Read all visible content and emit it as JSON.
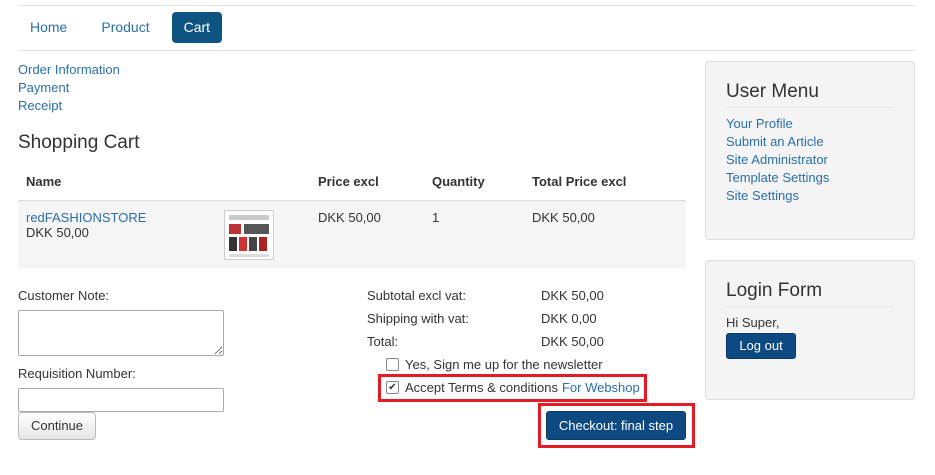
{
  "nav": {
    "items": [
      {
        "label": "Home",
        "active": false
      },
      {
        "label": "Product",
        "active": false
      },
      {
        "label": "Cart",
        "active": true
      }
    ]
  },
  "steps": [
    "Order Information",
    "Payment",
    "Receipt"
  ],
  "cart": {
    "title": "Shopping Cart",
    "columns": [
      "Name",
      "",
      "Price excl",
      "Quantity",
      "Total Price excl"
    ],
    "rows": [
      {
        "name": "redFASHIONSTORE",
        "sub_price": "DKK 50,00",
        "thumbnail": "product-thumbnail",
        "price_excl": "DKK 50,00",
        "quantity": "1",
        "total_excl": "DKK 50,00"
      }
    ]
  },
  "form": {
    "customer_note_label": "Customer Note:",
    "customer_note_value": "",
    "requisition_label": "Requisition Number:",
    "requisition_value": "",
    "continue_label": "Continue"
  },
  "totals": {
    "subtotal_label": "Subtotal excl vat:",
    "subtotal_value": "DKK 50,00",
    "shipping_label": "Shipping with vat:",
    "shipping_value": "DKK 0,00",
    "total_label": "Total:",
    "total_value": "DKK 50,00"
  },
  "options": {
    "newsletter_label": "Yes, Sign me up for the newsletter",
    "newsletter_checked": false,
    "terms_label": "Accept Terms & conditions",
    "terms_link": "For Webshop",
    "terms_checked": true
  },
  "checkout_label": "Checkout: final step",
  "user_menu": {
    "title": "User Menu",
    "items": [
      "Your Profile",
      "Submit an Article",
      "Site Administrator",
      "Template Settings",
      "Site Settings"
    ]
  },
  "login_form": {
    "title": "Login Form",
    "greeting": "Hi Super,",
    "logout_label": "Log out"
  },
  "colors": {
    "link": "#2b6ea8",
    "primary_button": "#0e4a82",
    "active_tab": "#0e5482",
    "highlight_frame": "#e21b24"
  }
}
